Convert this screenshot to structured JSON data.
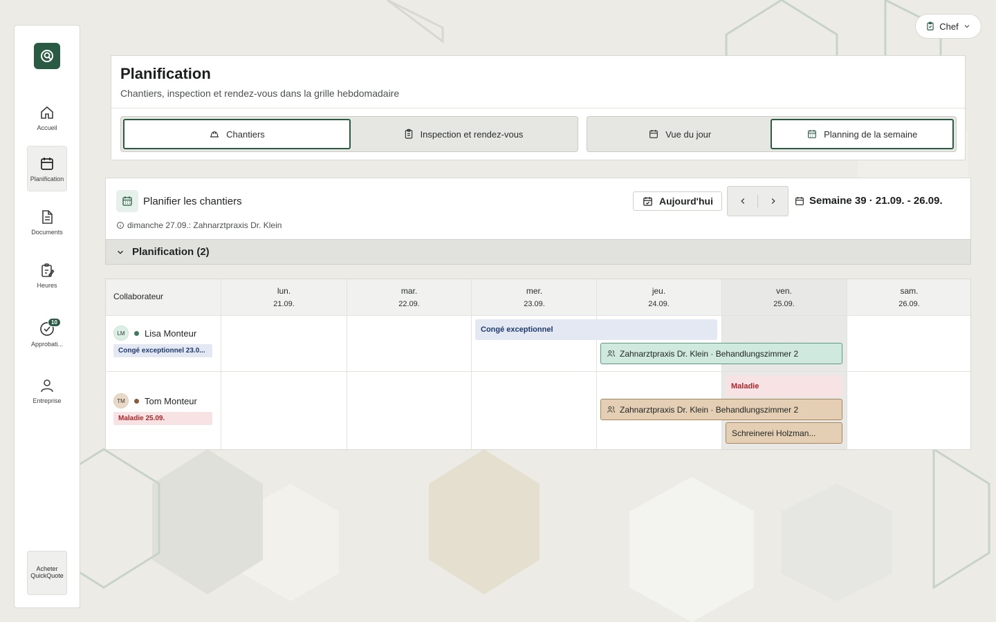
{
  "app": {
    "logo_icon": "quickquote-logo-icon",
    "brand_color": "#2a5a43"
  },
  "sidebar": {
    "items": [
      {
        "label": "Accueil",
        "icon": "home-icon",
        "active": false
      },
      {
        "label": "Planification",
        "icon": "calendar-icon",
        "active": true
      },
      {
        "label": "Documents",
        "icon": "document-icon",
        "active": false
      },
      {
        "label": "Heures",
        "icon": "clipboard-edit-icon",
        "active": false
      },
      {
        "label": "Approbati...",
        "icon": "check-circle-icon",
        "active": false,
        "badge": "10"
      },
      {
        "label": "Entreprise",
        "icon": "user-icon",
        "active": false
      }
    ],
    "buy_label": "Acheter QuickQuote"
  },
  "role_menu": {
    "label": "Chef"
  },
  "header": {
    "title": "Planification",
    "subtitle": "Chantiers, inspection et rendez-vous dans la grille hebdomadaire",
    "tabs_left": [
      {
        "label": "Chantiers",
        "icon": "hard-hat-icon",
        "active": true
      },
      {
        "label": "Inspection et rendez-vous",
        "icon": "clipboard-icon",
        "active": false
      }
    ],
    "tabs_right": [
      {
        "label": "Vue du jour",
        "icon": "calendar-icon",
        "active": false
      },
      {
        "label": "Planning de la semaine",
        "icon": "calendar-grid-icon",
        "active": true
      }
    ]
  },
  "planner": {
    "title": "Planifier les chantiers",
    "info": "dimanche 27.09.: Zahnarztpraxis Dr. Klein",
    "today_label": "Aujourd'hui",
    "week_label": "Semaine 39 · 21.09. - 26.09.",
    "group_label": "Planification (2)"
  },
  "grid": {
    "collab_header": "Collaborateur",
    "days": [
      {
        "name": "lun.",
        "date": "21.09."
      },
      {
        "name": "mar.",
        "date": "22.09."
      },
      {
        "name": "mer.",
        "date": "23.09."
      },
      {
        "name": "jeu.",
        "date": "24.09."
      },
      {
        "name": "ven.",
        "date": "25.09."
      },
      {
        "name": "sam.",
        "date": "26.09."
      }
    ],
    "highlight_day": "ven.",
    "rows": [
      {
        "initials": "LM",
        "name": "Lisa Monteur",
        "dot_color": "#3d7a5a",
        "avatar_color": "#dcefe5",
        "tag": "Congé exceptionnel 23.0...",
        "tag_bg": "#e3e8f3",
        "tag_fg": "#1f3a6b",
        "events": [
          {
            "label": "Congé exceptionnel",
            "kind": "absence-leave"
          },
          {
            "label": "Zahnarztpraxis Dr. Klein · Behandlungszimmer 2",
            "kind": "site-teal"
          }
        ]
      },
      {
        "initials": "TM",
        "name": "Tom Monteur",
        "dot_color": "#8a5a3a",
        "avatar_color": "#ead9c6",
        "tag": "Maladie 25.09.",
        "tag_bg": "#f7e3e3",
        "tag_fg": "#a8262c",
        "events": [
          {
            "label": "Maladie",
            "kind": "absence-sick"
          },
          {
            "label": "Zahnarztpraxis Dr. Klein · Behandlungszimmer 2",
            "kind": "site-tan"
          },
          {
            "label": "Schreinerei Holzman...",
            "kind": "site-tan"
          }
        ]
      }
    ]
  }
}
